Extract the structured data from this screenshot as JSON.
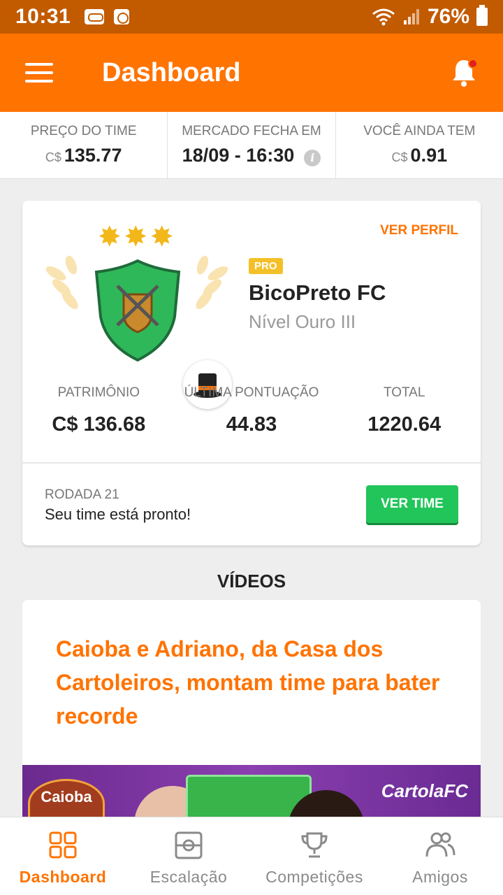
{
  "status_bar": {
    "time": "10:31",
    "battery": "76%"
  },
  "app_bar": {
    "title": "Dashboard"
  },
  "info_strip": {
    "team_price_label": "PREÇO DO TIME",
    "team_price_currency": "C$",
    "team_price_value": "135.77",
    "market_label": "MERCADO FECHA EM",
    "market_value": "18/09 - 16:30",
    "balance_label": "VOCÊ AINDA TEM",
    "balance_currency": "C$",
    "balance_value": "0.91"
  },
  "profile": {
    "ver_perfil": "VER PERFIL",
    "pro_badge": "PRO",
    "team_name": "BicoPreto FC",
    "level": "Nível Ouro III",
    "stats": [
      {
        "label": "PATRIMÔNIO",
        "value": "C$ 136.68"
      },
      {
        "label": "ÚLTIMA PONTUAÇÃO",
        "value": "44.83"
      },
      {
        "label": "TOTAL",
        "value": "1220.64"
      }
    ],
    "round_label": "RODADA 21",
    "round_status": "Seu time está pronto!",
    "ver_time": "VER TIME"
  },
  "videos": {
    "section_title": "VÍDEOS",
    "headline": "Caioba e Adriano, da Casa dos Cartoleiros, montam time para bater recorde",
    "thumb_logo_text": "Caioba",
    "thumb_brand_text": "CartolaFC"
  },
  "bottom_nav": [
    {
      "label": "Dashboard",
      "icon": "dashboard-grid-icon",
      "active": true
    },
    {
      "label": "Escalação",
      "icon": "field-icon",
      "active": false
    },
    {
      "label": "Competições",
      "icon": "trophy-icon",
      "active": false
    },
    {
      "label": "Amigos",
      "icon": "friends-icon",
      "active": false
    }
  ],
  "colors": {
    "primary": "#ff7300",
    "status_bar": "#c25a00",
    "accent_green": "#22c55a",
    "stars": "#f2b719",
    "pro_badge": "#f4c02a"
  }
}
